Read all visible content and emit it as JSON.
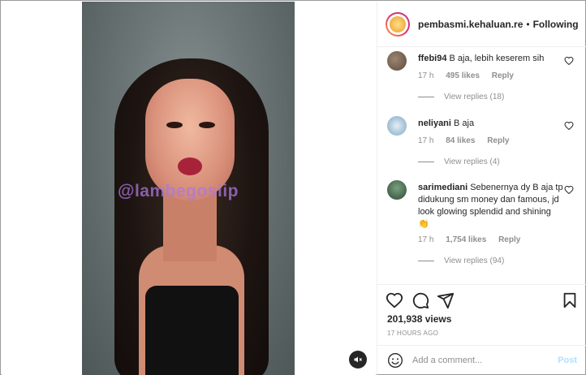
{
  "header": {
    "username": "pembasmi.kehaluan.re",
    "separator": "•",
    "follow_status": "Following"
  },
  "video": {
    "watermark": "@lambegosiip",
    "mute_icon": "speaker-muted-icon"
  },
  "comments": [
    {
      "username": "ffebi94",
      "text": "B aja, lebih keserem sih",
      "time": "17 h",
      "likes": "495 likes",
      "reply": "Reply",
      "view_replies": "View replies (18)",
      "avatar_color": "#6e5a48"
    },
    {
      "username": "neliyani",
      "text": "B aja",
      "time": "17 h",
      "likes": "84 likes",
      "reply": "Reply",
      "view_replies": "View replies (4)",
      "avatar_color": "#a8c3d8"
    },
    {
      "username": "sarimediani",
      "text": "Sebenernya dy B aja tp didukung sm money dan famous, jd look glowing splendid and shining 👏",
      "time": "17 h",
      "likes": "1,754 likes",
      "reply": "Reply",
      "view_replies": "View replies (94)",
      "avatar_color": "#3d5f4a"
    }
  ],
  "stats": {
    "views": "201,938 views",
    "timestamp": "17 HOURS AGO"
  },
  "comment_bar": {
    "placeholder": "Add a comment...",
    "post_label": "Post"
  },
  "colors": {
    "link_blue_disabled": "#b2dffc",
    "secondary_text": "#8e8e8e",
    "border": "#efefef"
  }
}
